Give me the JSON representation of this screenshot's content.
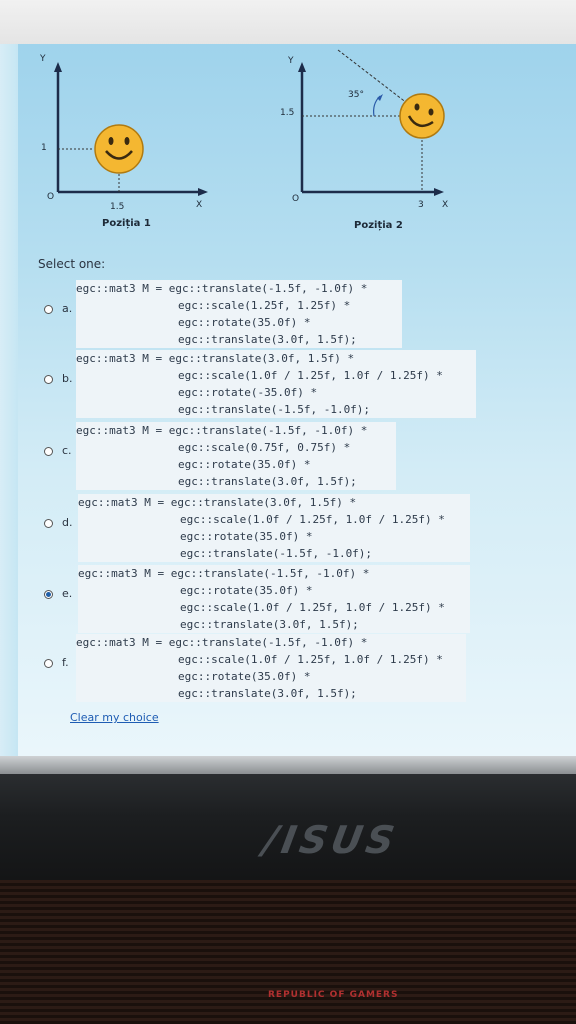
{
  "graph1": {
    "y_label": "Y",
    "x_label": "X",
    "origin": "O",
    "y_tick": "1",
    "x_tick": "1.5",
    "caption": "Poziția 1"
  },
  "graph2": {
    "y_label": "Y",
    "x_label": "X",
    "origin": "O",
    "y_tick": "1.5",
    "x_tick": "3",
    "angle": "35°",
    "caption": "Poziția 2"
  },
  "select_label": "Select one:",
  "options": [
    {
      "letter": "a.",
      "checked": false,
      "lines": [
        "egc::mat3 M = egc::translate(-1.5f, -1.0f) *",
        "egc::scale(1.25f, 1.25f) *",
        "egc::rotate(35.0f) *",
        "egc::translate(3.0f, 1.5f);"
      ]
    },
    {
      "letter": "b.",
      "checked": false,
      "lines": [
        "egc::mat3 M = egc::translate(3.0f, 1.5f) *",
        "egc::scale(1.0f / 1.25f, 1.0f / 1.25f) *",
        "egc::rotate(-35.0f) *",
        "egc::translate(-1.5f, -1.0f);"
      ]
    },
    {
      "letter": "c.",
      "checked": false,
      "lines": [
        "egc::mat3 M = egc::translate(-1.5f, -1.0f) *",
        "egc::scale(0.75f, 0.75f) *",
        "egc::rotate(35.0f) *",
        "egc::translate(3.0f, 1.5f);"
      ]
    },
    {
      "letter": "d.",
      "checked": false,
      "lines": [
        "egc::mat3 M = egc::translate(3.0f, 1.5f) *",
        "egc::scale(1.0f / 1.25f, 1.0f / 1.25f) *",
        "egc::rotate(35.0f) *",
        "egc::translate(-1.5f, -1.0f);"
      ]
    },
    {
      "letter": "e.",
      "checked": true,
      "lines": [
        "egc::mat3 M = egc::translate(-1.5f, -1.0f) *",
        "egc::rotate(35.0f) *",
        "egc::scale(1.0f / 1.25f, 1.0f / 1.25f) *",
        "egc::translate(3.0f, 1.5f);"
      ]
    },
    {
      "letter": "f.",
      "checked": false,
      "lines": [
        "egc::mat3 M = egc::translate(-1.5f, -1.0f) *",
        "egc::scale(1.0f / 1.25f, 1.0f / 1.25f) *",
        "egc::rotate(35.0f) *",
        "egc::translate(3.0f, 1.5f);"
      ]
    }
  ],
  "clear_choice": "Clear my choice",
  "laptop_logo": "/ISUS",
  "keyboard_brand": "REPUBLIC OF GAMERS"
}
